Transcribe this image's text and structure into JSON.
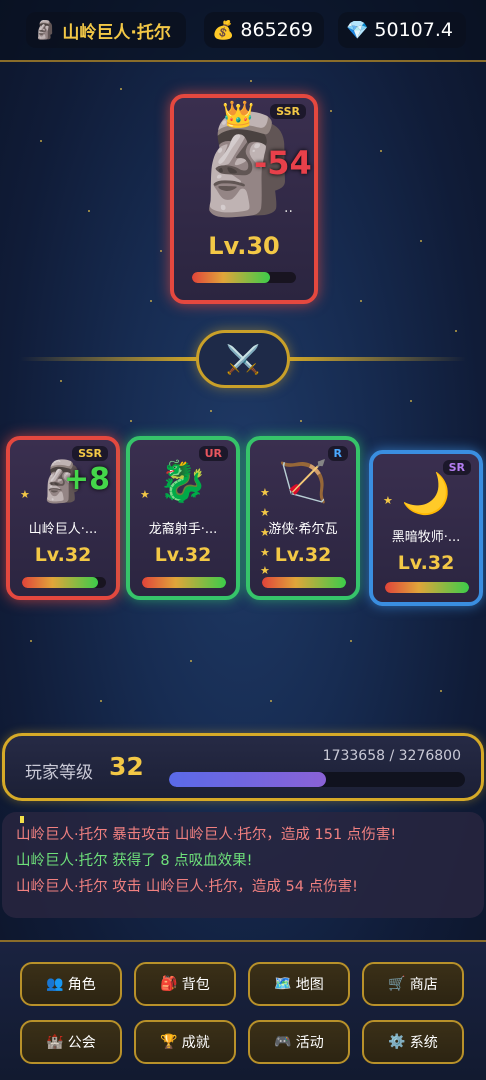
{
  "header": {
    "player_icon": "moai-icon",
    "player_name": "山岭巨人·托尔",
    "gold_icon": "money-bag-icon",
    "gold": "865269",
    "gem_icon": "diamond-icon",
    "gems": "50107.4"
  },
  "enemy": {
    "rarity": "SSR",
    "portrait": "🗿",
    "crown": "👑",
    "damage": "-54",
    "dots": "..",
    "level": "Lv.30",
    "hp_fraction": 0.75
  },
  "vs_icon": "⚔️",
  "heroes": [
    {
      "rarity": "SSR",
      "portrait": "🗿",
      "name": "山岭巨人·...",
      "level": "Lv.32",
      "hp_fraction": 0.91,
      "popup": "+8"
    },
    {
      "rarity": "UR",
      "portrait": "🐉",
      "name": "龙裔射手·...",
      "level": "Lv.32",
      "hp_fraction": 1.0
    },
    {
      "rarity": "R",
      "portrait": "🏹",
      "name": "游侠·希尔瓦",
      "level": "Lv.32",
      "hp_fraction": 1.0
    },
    {
      "rarity": "SR",
      "portrait": "🌙",
      "name": "黑暗牧师·...",
      "level": "Lv.32",
      "hp_fraction": 1.0
    }
  ],
  "player_level": {
    "label": "玩家等级",
    "level": "32",
    "xp_text": "1733658 / 3276800",
    "xp_fraction": 0.529
  },
  "log": [
    {
      "text": "山岭巨人·托尔 暴击攻击 山岭巨人·托尔，造成 151 点伤害!",
      "color": "red"
    },
    {
      "text": "山岭巨人·托尔 获得了 8 点吸血效果!",
      "color": "green"
    },
    {
      "text": "山岭巨人·托尔 攻击 山岭巨人·托尔，造成 54 点伤害!",
      "color": "red"
    }
  ],
  "menu": [
    {
      "icon": "👥",
      "label": "角色"
    },
    {
      "icon": "🎒",
      "label": "背包"
    },
    {
      "icon": "🗺️",
      "label": "地图"
    },
    {
      "icon": "🛒",
      "label": "商店"
    },
    {
      "icon": "🏰",
      "label": "公会"
    },
    {
      "icon": "🏆",
      "label": "成就"
    },
    {
      "icon": "🎮",
      "label": "活动"
    },
    {
      "icon": "⚙️",
      "label": "系统"
    }
  ],
  "colors": {
    "gold": "#f3c846",
    "ssr_border": "#e4483f",
    "ur_border": "#36c46a",
    "sr_border": "#3a8ee0"
  }
}
